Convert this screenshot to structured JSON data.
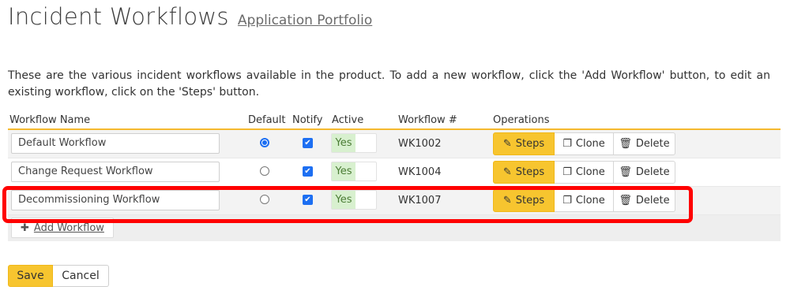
{
  "header": {
    "title": "Incident Workflows",
    "portfolio_link": "Application Portfolio"
  },
  "intro": "These are the various incident workflows available in the product. To add a new workflow, click the 'Add Workflow' button, to edit an existing workflow, click on the 'Steps' button.",
  "table": {
    "columns": {
      "name": "Workflow Name",
      "default": "Default",
      "notify": "Notify",
      "active": "Active",
      "number": "Workflow #",
      "operations": "Operations"
    },
    "rows": [
      {
        "name": "Default Workflow",
        "default": true,
        "notify": true,
        "active": "Yes",
        "number": "WK1002"
      },
      {
        "name": "Change Request Workflow",
        "default": false,
        "notify": true,
        "active": "Yes",
        "number": "WK1004"
      },
      {
        "name": "Decommissioning Workflow",
        "default": false,
        "notify": true,
        "active": "Yes",
        "number": "WK1007"
      }
    ],
    "operations": {
      "steps": "Steps",
      "clone": "Clone",
      "delete": "Delete"
    },
    "add_label": "Add Workflow"
  },
  "footer": {
    "save": "Save",
    "cancel": "Cancel"
  },
  "colors": {
    "accent": "#f7c52f",
    "checkbox": "#1d6ff2",
    "highlight": "#ff0000",
    "active_bg": "#d8f0cf"
  },
  "icons": {
    "steps": "edit-icon",
    "clone": "clone-icon",
    "delete": "trash-icon",
    "add": "plus-icon",
    "check": "check-icon"
  }
}
